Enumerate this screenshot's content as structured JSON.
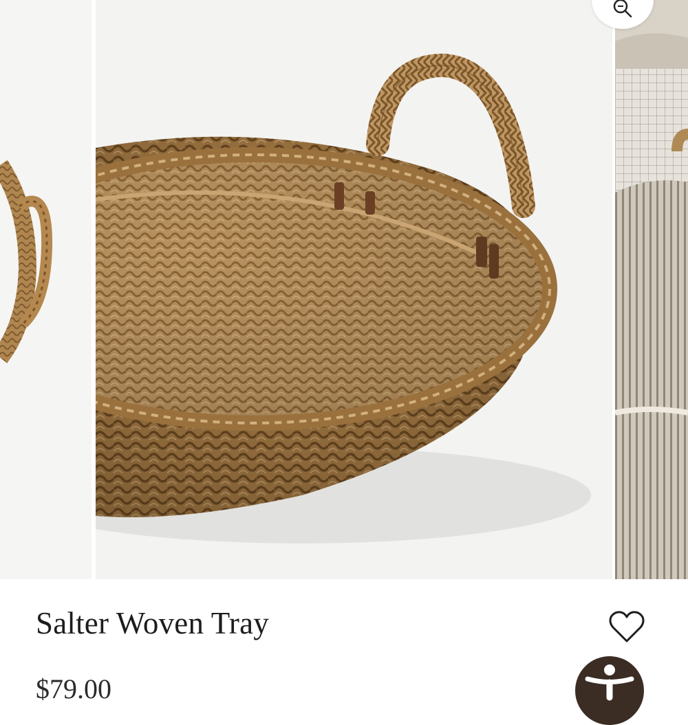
{
  "product": {
    "title": "Salter Woven Tray",
    "price": "$79.00"
  },
  "gallery": {
    "slides": [
      "woven-tray-side",
      "woven-tray-angle",
      "woven-tray-lifestyle"
    ],
    "active_slide": 2
  },
  "icons": {
    "zoom": "magnifier-icon",
    "wishlist": "heart-outline-icon",
    "accessibility": "accessibility-person-icon"
  },
  "colors": {
    "text": "#1d1d1d",
    "accessibility_button": "#3b2c24",
    "wicker": "#b48c58"
  }
}
